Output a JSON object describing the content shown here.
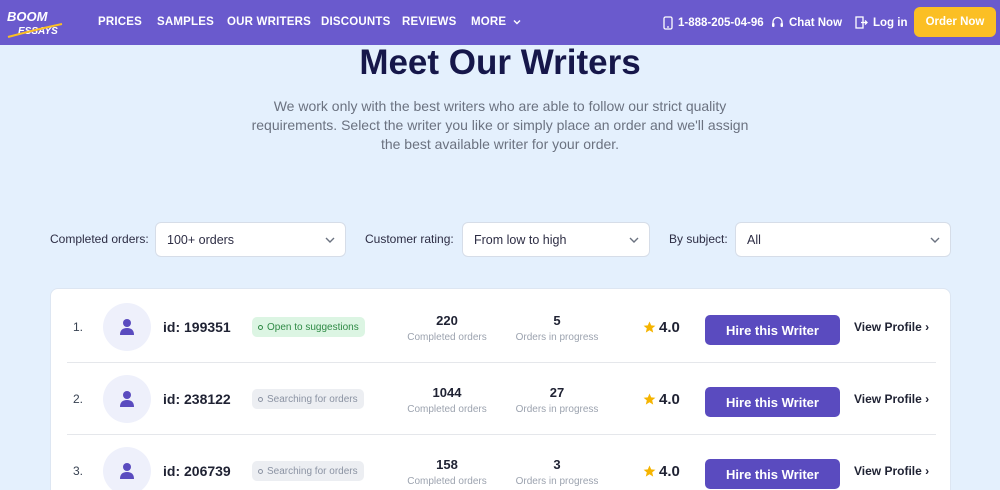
{
  "colors": {
    "nav_bg": "#6a5acd",
    "accent": "#5a4bbf",
    "cta": "#fbbf24",
    "page_bg": "#e4f0fd",
    "star": "#f5b400"
  },
  "nav": {
    "logo_top": "BOOM",
    "logo_bottom": "ESSAYS",
    "links": [
      "PRICES",
      "SAMPLES",
      "OUR WRITERS",
      "DISCOUNTS",
      "REVIEWS",
      "MORE"
    ],
    "phone": "1-888-205-04-96",
    "chat": "Chat Now",
    "login": "Log in",
    "order": "Order Now",
    "icons": {
      "phone": "phone-icon",
      "chat": "headset-icon",
      "login": "login-icon",
      "more": "chevron-down-icon"
    }
  },
  "hero": {
    "title": "Meet Our Writers",
    "subtitle": "We work only with the best writers who are able to follow our strict quality requirements. Select the writer you like or simply place an order and we'll assign the best available writer for your order."
  },
  "filters": {
    "completed_label": "Completed orders:",
    "completed_value": "100+ orders",
    "rating_label": "Customer rating:",
    "rating_value": "From low to high",
    "subject_label": "By subject:",
    "subject_value": "All"
  },
  "writers": [
    {
      "num": "1.",
      "id": "id: 199351",
      "status": "Open to suggestions",
      "completed": "220",
      "completed_label": "Completed orders",
      "progress": "5",
      "progress_label": "Orders in progress",
      "rating": "4.0",
      "hire": "Hire this Writer",
      "view": "View Profile ›"
    },
    {
      "num": "2.",
      "id": "id: 238122",
      "status": "Searching for orders",
      "completed": "1044",
      "completed_label": "Completed orders",
      "progress": "27",
      "progress_label": "Orders in progress",
      "rating": "4.0",
      "hire": "Hire this Writer",
      "view": "View Profile ›"
    },
    {
      "num": "3.",
      "id": "id: 206739",
      "status": "Searching for orders",
      "completed": "158",
      "completed_label": "Completed orders",
      "progress": "3",
      "progress_label": "Orders in progress",
      "rating": "4.0",
      "hire": "Hire this Writer",
      "view": "View Profile ›"
    }
  ]
}
